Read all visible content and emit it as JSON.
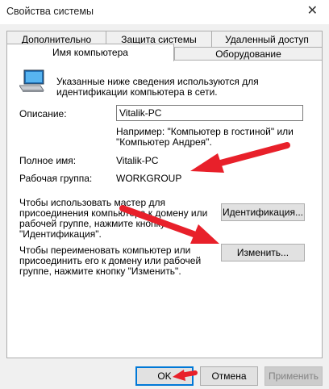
{
  "window": {
    "title": "Свойства системы",
    "close_glyph": "✕"
  },
  "tabs": {
    "top_row": [
      "Дополнительно",
      "Защита системы",
      "Удаленный доступ"
    ],
    "bottom_row": [
      "Имя компьютера",
      "Оборудование"
    ],
    "active": "Имя компьютера"
  },
  "computer_name": {
    "intro": [
      "Указанные ниже сведения используются для",
      "идентификации компьютера в сети."
    ],
    "description_label": "Описание:",
    "description_value": "Vitalik-PC",
    "example": [
      "Например: \"Компьютер в гостиной\" или",
      "\"Компьютер Андрея\"."
    ],
    "fullname_label": "Полное имя:",
    "fullname_value": "Vitalik-PC",
    "workgroup_label": "Рабочая группа:",
    "workgroup_value": "WORKGROUP",
    "wizard_text": [
      "Чтобы использовать мастер для",
      "присоединения компьютера к домену или",
      "рабочей группе, нажмите кнопку",
      "\"Идентификация\"."
    ],
    "identify_button": "Идентификация...",
    "rename_text": [
      "Чтобы переименовать компьютер или",
      "присоединить его к домену или рабочей",
      "группе, нажмите кнопку \"Изменить\"."
    ],
    "change_button": "Изменить..."
  },
  "footer": {
    "ok": "OK",
    "cancel": "Отмена",
    "apply": "Применить"
  },
  "colors": {
    "arrow": "#e8202a",
    "accent": "#0078d7"
  },
  "icons": {
    "computer": "computer-icon",
    "close": "close-icon"
  }
}
